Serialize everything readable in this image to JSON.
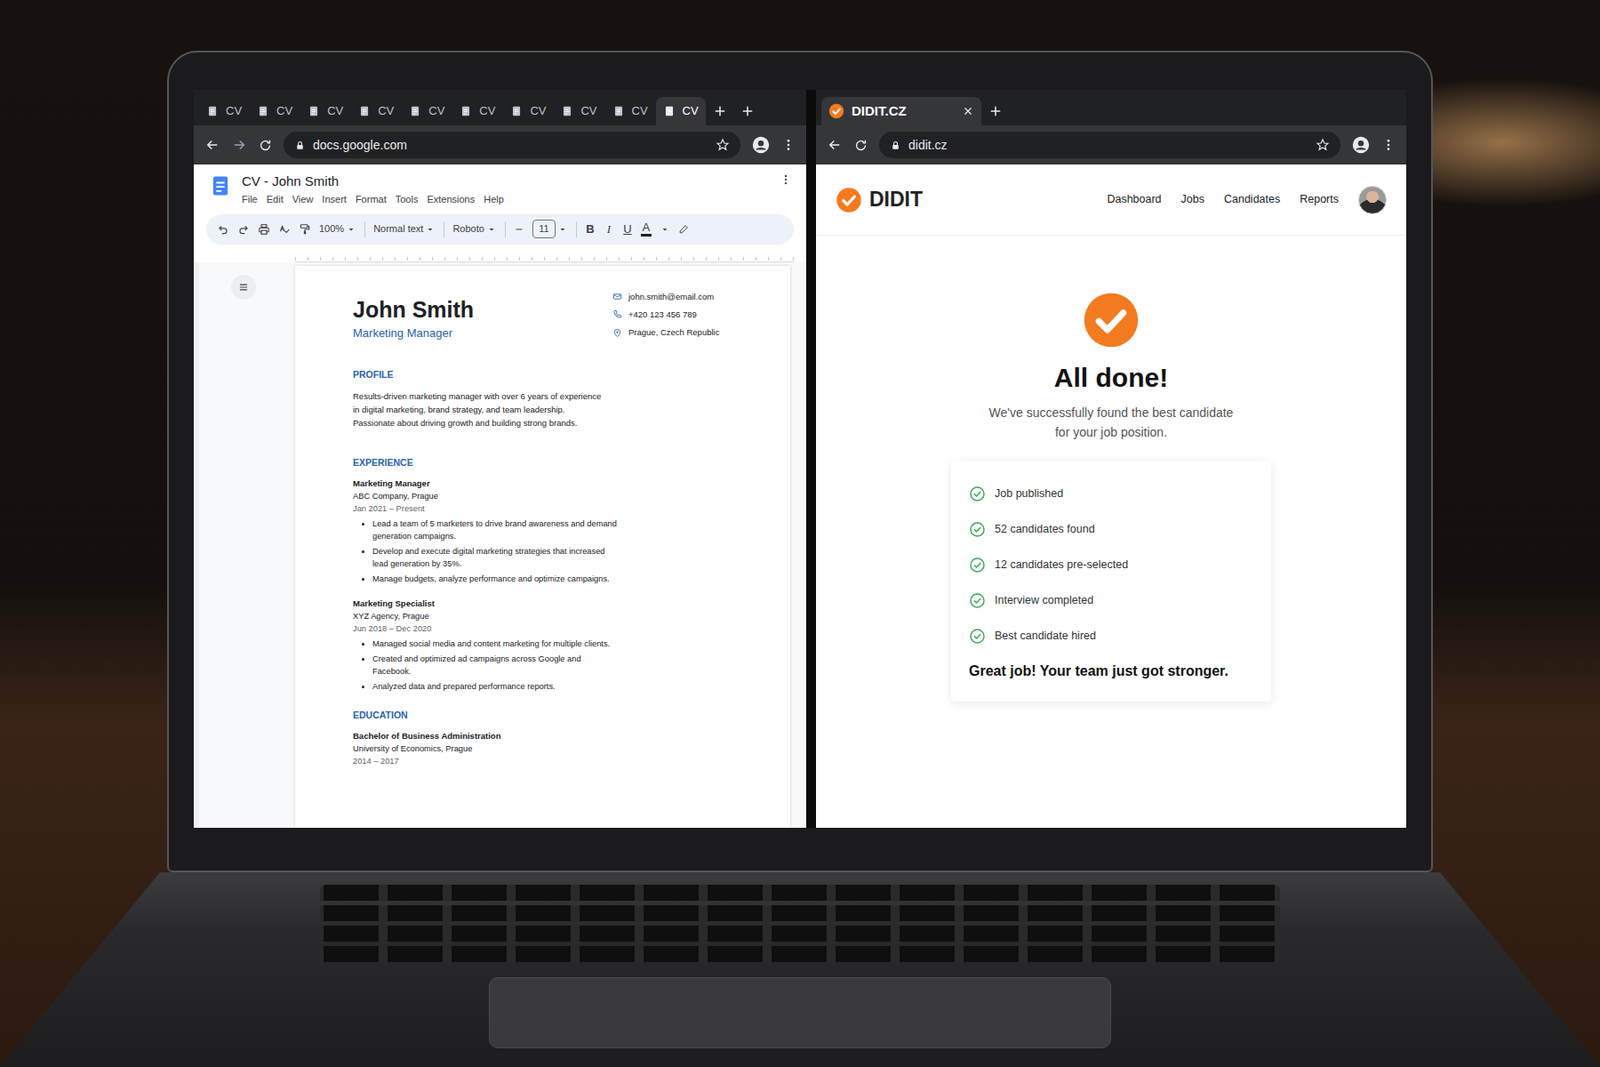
{
  "left_window": {
    "tabs": [
      {
        "label": "CV",
        "selected": false
      },
      {
        "label": "CV",
        "selected": false
      },
      {
        "label": "CV",
        "selected": false
      },
      {
        "label": "CV",
        "selected": false
      },
      {
        "label": "CV",
        "selected": false
      },
      {
        "label": "CV",
        "selected": false
      },
      {
        "label": "CV",
        "selected": false
      },
      {
        "label": "CV",
        "selected": false
      },
      {
        "label": "CV",
        "selected": false
      },
      {
        "label": "CV",
        "selected": true
      }
    ],
    "address": "docs.google.com",
    "doc_title": "CV - John Smith",
    "menu": [
      "File",
      "Edit",
      "View",
      "Insert",
      "Format",
      "Tools",
      "Extensions",
      "Help"
    ],
    "toolbar": {
      "zoom": "100%",
      "style": "Normal text",
      "font": "Roboto",
      "size": "11",
      "format_buttons": [
        "B",
        "I",
        "U",
        "A"
      ]
    },
    "cv": {
      "name": "John Smith",
      "role": "Marketing Manager",
      "contacts": [
        {
          "kind": "email",
          "text": "john.smith@email.com"
        },
        {
          "kind": "phone",
          "text": "+420 123 456 789"
        },
        {
          "kind": "location",
          "text": "Prague, Czech Republic"
        }
      ],
      "profile": {
        "heading": "PROFILE",
        "lines": [
          "Results-driven marketing manager with over 6 years of experience",
          "in digital marketing, brand strategy, and team leadership.",
          "Passionate about driving growth and building strong brands."
        ]
      },
      "experience": {
        "heading": "EXPERIENCE",
        "jobs": [
          {
            "title": "Marketing Manager",
            "company": "ABC Company, Prague",
            "dates": "Jan 2021 – Present",
            "bullets": [
              "Lead a team of 5 marketers to drive brand awareness and demand generation campaigns.",
              "Develop and execute digital marketing strategies that increased lead generation by 35%.",
              "Manage budgets, analyze performance and optimize campaigns."
            ]
          },
          {
            "title": "Marketing Specialist",
            "company": "XYZ Agency, Prague",
            "dates": "Jun 2018 – Dec 2020",
            "bullets": [
              "Managed social media and content marketing for multiple clients.",
              "Created and optimized ad campaigns across Google and Facebook.",
              "Analyzed data and prepared performance reports."
            ]
          }
        ]
      },
      "education": {
        "heading": "EDUCATION",
        "degree": "Bachelor of Business Administration",
        "school": "University of Economics, Prague",
        "dates": "2014 – 2017"
      }
    }
  },
  "right_window": {
    "tabs": [
      {
        "label": "DIDIT.CZ",
        "selected": true
      }
    ],
    "address": "didit.cz",
    "brand": "DIDIT",
    "nav": [
      "Dashboard",
      "Jobs",
      "Candidates",
      "Reports"
    ],
    "title": "All done!",
    "subtitle_lines": [
      "We've successfully found the best candidate",
      "for your job position."
    ],
    "steps": [
      {
        "label": "Job published",
        "done": true
      },
      {
        "label": "52 candidates found",
        "done": true
      },
      {
        "label": "12 candidates pre-selected",
        "done": true
      },
      {
        "label": "Interview completed",
        "done": true
      },
      {
        "label": "Best candidate hired",
        "done": true
      }
    ],
    "footer": "Great job! Your team just got stronger."
  }
}
